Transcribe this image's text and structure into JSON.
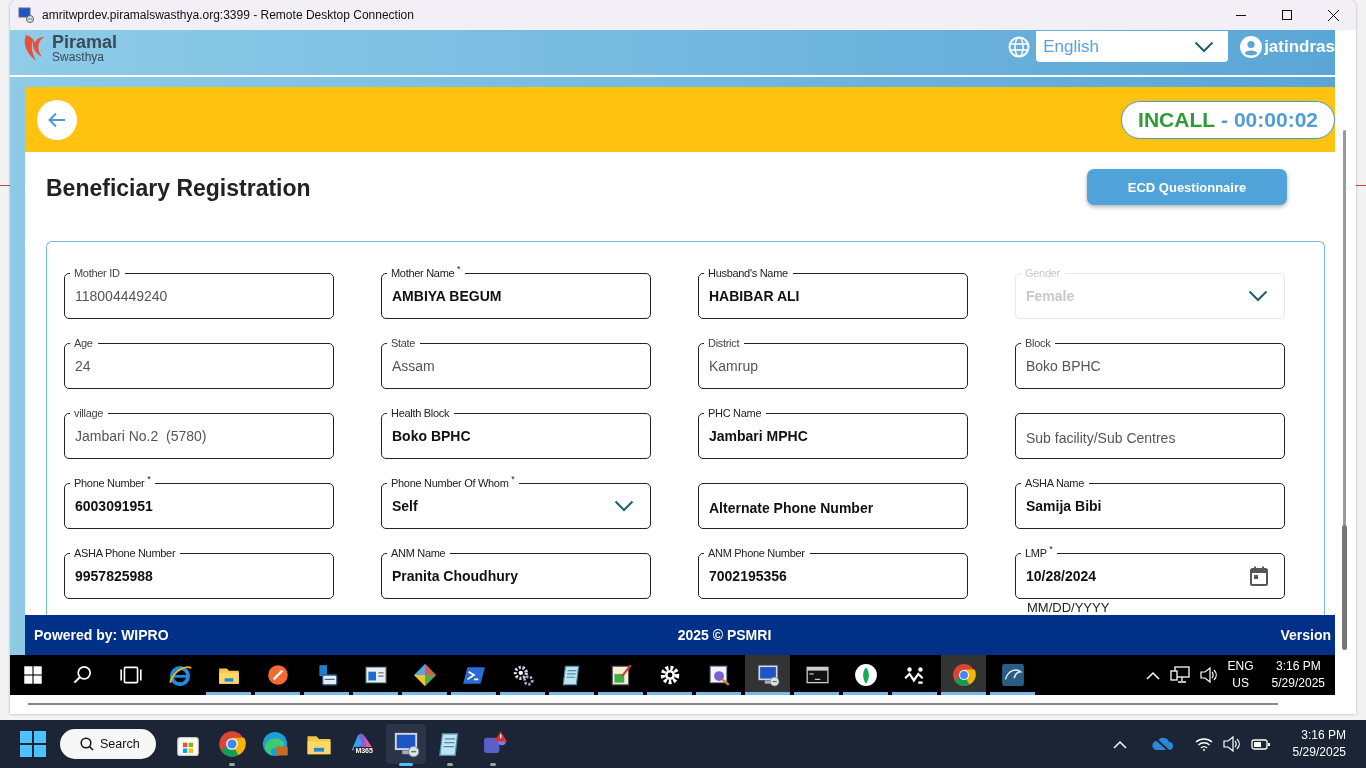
{
  "rdp_window": {
    "title": "amritwprdev.piramalswasthya.org:3399 - Remote Desktop Connection"
  },
  "app_header": {
    "logo_name": "Piramal",
    "logo_sub": "Swasthya",
    "language": "English",
    "user": "jatindras"
  },
  "call_bar": {
    "status": "INCALL",
    "separator": "-",
    "timer": "00:00:02"
  },
  "page": {
    "title": "Beneficiary Registration",
    "action_button": "ECD Questionnaire"
  },
  "fields": [
    {
      "label": "Mother ID",
      "value": "118004449240",
      "kind": "text",
      "readonly": true,
      "disabled": false
    },
    {
      "label": "Mother Name $^{*}$",
      "value": "AMBIYA BEGUM",
      "kind": "text",
      "readonly": false,
      "disabled": false
    },
    {
      "label": "Husband's Name",
      "value": "HABIBAR ALI",
      "kind": "text",
      "readonly": false,
      "disabled": false
    },
    {
      "label": "Gender",
      "value": "Female",
      "kind": "select",
      "readonly": false,
      "disabled": true
    },
    {
      "label": "Age",
      "value": "24",
      "kind": "text",
      "readonly": true,
      "disabled": false
    },
    {
      "label": "State",
      "value": "Assam",
      "kind": "text",
      "readonly": true,
      "disabled": false
    },
    {
      "label": "District",
      "value": "Kamrup",
      "kind": "text",
      "readonly": true,
      "disabled": false
    },
    {
      "label": "Block",
      "value": "Boko BPHC",
      "kind": "text",
      "readonly": true,
      "disabled": false
    },
    {
      "label": "village",
      "value": "Jambari No.2  (5780)",
      "kind": "text",
      "readonly": true,
      "disabled": false
    },
    {
      "label": "Health Block",
      "value": "Boko BPHC",
      "kind": "text",
      "readonly": false,
      "disabled": false
    },
    {
      "label": "PHC Name",
      "value": "Jambari MPHC",
      "kind": "text",
      "readonly": false,
      "disabled": false
    },
    {
      "placeholder": "Sub facility/Sub Centres",
      "kind": "text",
      "readonly": true,
      "disabled": false
    },
    {
      "label": "Phone Number $^{*}$",
      "value": "6003091951",
      "kind": "text",
      "readonly": false,
      "disabled": false
    },
    {
      "label": "Phone Number Of Whom $^{*}$",
      "value": "Self",
      "kind": "select",
      "readonly": false,
      "disabled": false
    },
    {
      "placeholder": "Alternate Phone Number",
      "kind": "text",
      "readonly": false,
      "disabled": false
    },
    {
      "label": "ASHA Name",
      "value": "Samija Bibi",
      "kind": "text",
      "readonly": false,
      "disabled": false
    },
    {
      "label": "ASHA Phone Number",
      "value": "9957825988",
      "kind": "text",
      "readonly": false,
      "disabled": false
    },
    {
      "label": "ANM Name",
      "value": "Pranita Choudhury",
      "kind": "text",
      "readonly": false,
      "disabled": false
    },
    {
      "label": "ANM Phone Number",
      "value": "7002195356",
      "kind": "text",
      "readonly": false,
      "disabled": false
    },
    {
      "label": "LMP $^{*}$",
      "value": "10/28/2024",
      "kind": "date",
      "readonly": false,
      "disabled": false,
      "hint": "MM/DD/YYYY"
    }
  ],
  "footer": {
    "left": "Powered by: WIPRO",
    "center": "2025 © PSMRI",
    "right": "Version"
  },
  "remote_taskbar": {
    "apps": [
      {
        "kind": "start",
        "selected": false,
        "running": false
      },
      {
        "kind": "search",
        "selected": false,
        "running": false
      },
      {
        "kind": "taskview",
        "selected": false,
        "running": false
      },
      {
        "kind": "ie",
        "selected": false,
        "running": false
      },
      {
        "kind": "folder",
        "selected": false,
        "running": true
      },
      {
        "kind": "pen",
        "selected": false,
        "running": true
      },
      {
        "kind": "docs",
        "selected": false,
        "running": true
      },
      {
        "kind": "window",
        "selected": false,
        "running": true
      },
      {
        "kind": "diamond",
        "selected": false,
        "running": true
      },
      {
        "kind": "shell",
        "selected": false,
        "running": true
      },
      {
        "kind": "gears",
        "selected": false,
        "running": true
      },
      {
        "kind": "notepad",
        "selected": false,
        "running": true
      },
      {
        "kind": "editor",
        "selected": false,
        "running": true
      },
      {
        "kind": "settings",
        "selected": false,
        "running": true
      },
      {
        "kind": "viewer",
        "selected": false,
        "running": true
      },
      {
        "kind": "monitor",
        "selected": true,
        "running": true
      },
      {
        "kind": "console",
        "selected": false,
        "running": true
      },
      {
        "kind": "leaf",
        "selected": false,
        "running": true
      },
      {
        "kind": "arrows",
        "selected": false,
        "running": true
      },
      {
        "kind": "chrome",
        "selected": true,
        "running": true
      },
      {
        "kind": "database",
        "selected": false,
        "running": true
      }
    ],
    "tray": {
      "language": "ENG",
      "region": "US",
      "time": "3:16 PM",
      "date": "5/29/2025"
    }
  },
  "host_taskbar": {
    "search": "Search",
    "apps": [
      {
        "kind": "store",
        "selected": false,
        "running": false
      },
      {
        "kind": "chrome",
        "selected": false,
        "running": true
      },
      {
        "kind": "edge",
        "selected": false,
        "running": false
      },
      {
        "kind": "folder",
        "selected": false,
        "running": false
      },
      {
        "kind": "office",
        "selected": false,
        "running": false,
        "badge": "M365"
      },
      {
        "kind": "monitor",
        "selected": true,
        "running": true
      },
      {
        "kind": "notepad",
        "selected": false,
        "running": true
      },
      {
        "kind": "teams",
        "selected": false,
        "running": true
      }
    ],
    "time": "3:16 PM",
    "date": "5/29/2025"
  }
}
